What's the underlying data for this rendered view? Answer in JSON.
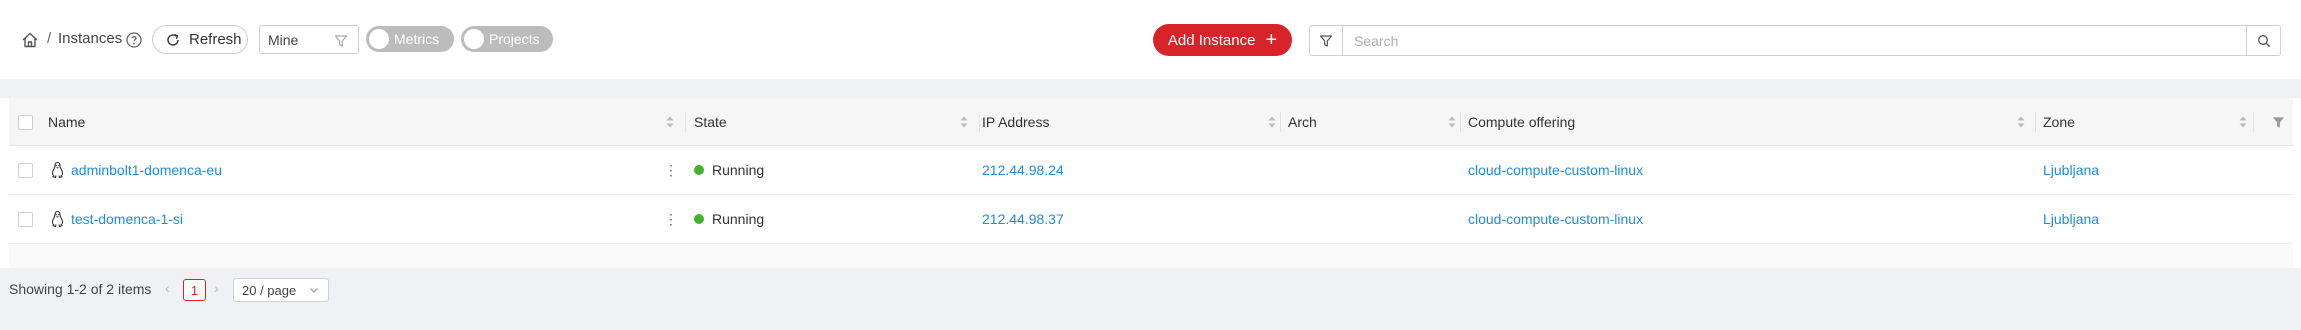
{
  "breadcrumb": {
    "separator": "/",
    "title": "Instances"
  },
  "toolbar": {
    "refresh_label": "Refresh",
    "filter_value": "Mine",
    "metrics_label": "Metrics",
    "projects_label": "Projects",
    "add_label": "Add Instance",
    "search_placeholder": "Search"
  },
  "table": {
    "columns": [
      "Name",
      "State",
      "IP Address",
      "Arch",
      "Compute offering",
      "Zone"
    ],
    "rows": [
      {
        "name": "adminbolt1-domenca-eu",
        "state": "Running",
        "ip": "212.44.98.24",
        "arch": "",
        "offering": "cloud-compute-custom-linux",
        "zone": "Ljubljana"
      },
      {
        "name": "test-domenca-1-si",
        "state": "Running",
        "ip": "212.44.98.37",
        "arch": "",
        "offering": "cloud-compute-custom-linux",
        "zone": "Ljubljana"
      }
    ]
  },
  "pagination": {
    "total_text": "Showing 1-2 of 2 items",
    "current_page": "1",
    "page_size": "20 / page"
  },
  "colors": {
    "accent": "#d7242a",
    "link": "#1f8ce0",
    "running": "#42b42b"
  },
  "icons": [
    "home-icon",
    "help-icon",
    "refresh-icon",
    "funnel-icon",
    "plus-icon",
    "search-icon",
    "sort-icon",
    "linux-icon",
    "more-vertical-icon",
    "chevron-down-icon"
  ]
}
